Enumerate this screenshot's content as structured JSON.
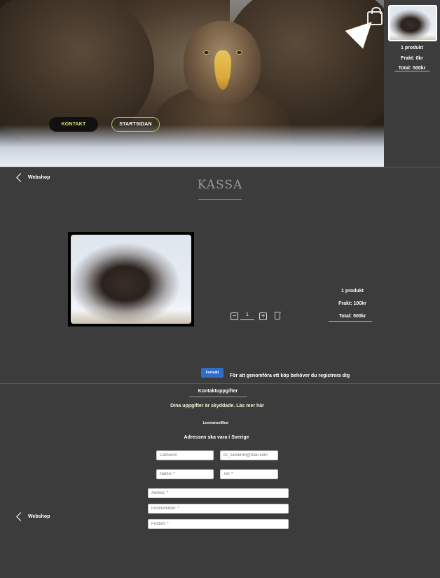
{
  "hero": {
    "buttons": {
      "kontakt": "KONTAKT",
      "startsidan": "STARTSIDAN"
    }
  },
  "side_cart": {
    "products": "1 produkt",
    "shipping": "Frakt: 0kr",
    "total": "Total: 500kr"
  },
  "nav": {
    "back_label": "Webshop"
  },
  "page_title": "KASSA",
  "cart_item": {
    "quantity": "1"
  },
  "summary": {
    "products": "1 produkt",
    "shipping": "Frakt: 100kr",
    "total": "Total: 500kr"
  },
  "checkout": {
    "continue_label": "Fortsätt",
    "register_note": "För att genomföra ett köp behöver du registrera dig"
  },
  "contact": {
    "title": "Kontaktuppgifter",
    "privacy_note": "Dina uppgifter är skyddade. Läs mer här",
    "terms": "Leveransvillkor",
    "country_note": "Adressen ska vara i Sverige",
    "fields": {
      "name_placeholder": "Cameron",
      "email_placeholder": "cc_cameron@mail.com",
      "lastname_placeholder": "Namn: *",
      "phone_placeholder": "Tel: *",
      "address_placeholder": "Adress: *",
      "postal_placeholder": "Postnummer: *",
      "city_placeholder": "Postort: *"
    }
  },
  "colors": {
    "background": "#3c3c3c",
    "accent_green": "#a7d25b",
    "button_blue": "#2f6dc7"
  }
}
